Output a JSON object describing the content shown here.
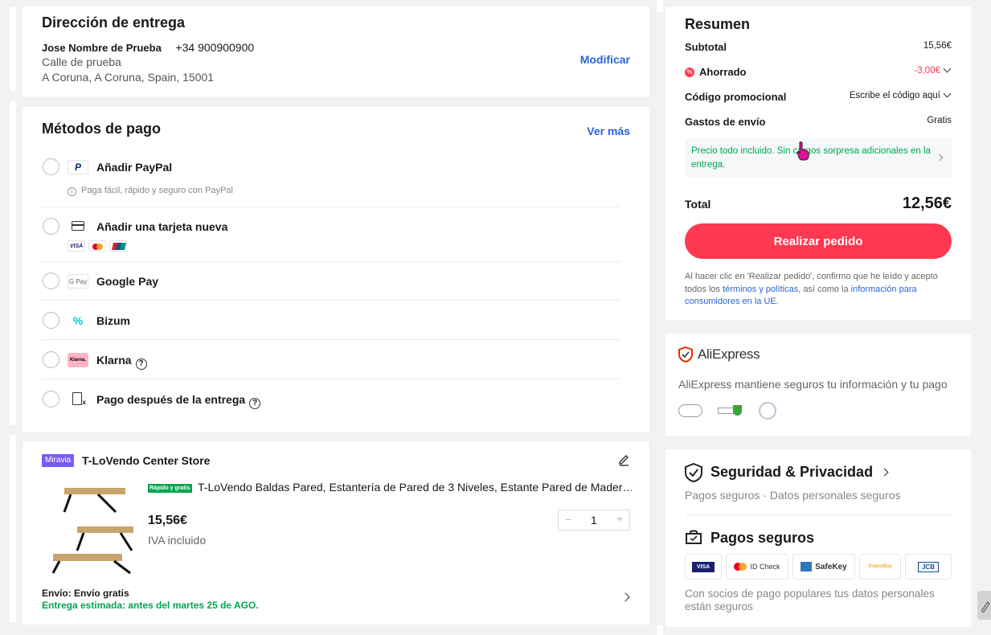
{
  "address": {
    "title": "Dirección de entrega",
    "name": "Jose Nombre de Prueba",
    "phone": "+34 900900900",
    "street": "Calle de prueba",
    "city": "A Coruna, A Coruna, Spain, 15001",
    "edit_label": "Modificar"
  },
  "payment": {
    "title": "Métodos de pago",
    "more_label": "Ver más",
    "methods": [
      {
        "label": "Añadir PayPal",
        "note": "Paga fácil, rápido y seguro con PayPal",
        "icon": "paypal-icon"
      },
      {
        "label": "Añadir una tarjeta nueva",
        "icon": "card-icon",
        "brands": [
          "VISA",
          "MC",
          "UP"
        ]
      },
      {
        "label": "Google Pay",
        "icon": "gpay-icon",
        "icon_text": "G Pay"
      },
      {
        "label": "Bizum",
        "icon": "bizum-icon"
      },
      {
        "label": "Klarna",
        "icon": "klarna-icon",
        "icon_text": "Klarna."
      },
      {
        "label": "Pago después de la entrega",
        "icon": "cod-icon"
      }
    ]
  },
  "order": {
    "store_badge": "Miravia",
    "store_name": "T-LoVendo Center Store",
    "fast_badge": "Rápido y gratis",
    "product_title": "T-LoVendo Baldas Pared, Estantería de Pared de 3 Niveles, Estante Pared de Mader…",
    "price": "15,56€",
    "tax_note": "IVA incluido",
    "quantity": "1",
    "shipping_label": "Envío: Envío gratis",
    "delivery_label": "Entrega estimada: antes del martes 25 de AGO."
  },
  "summary": {
    "title": "Resumen",
    "subtotal_label": "Subtotal",
    "subtotal_value": "15,56€",
    "saved_label": "Ahorrado",
    "saved_value": "-3,00€",
    "promo_label": "Código promocional",
    "promo_value": "Escribe el código aquí",
    "shipping_label": "Gastos de envío",
    "shipping_value": "Gratis",
    "notice": "Precio todo incluido. Sin cargos sorpresa adicionales en la entrega.",
    "total_label": "Total",
    "total_value": "12,56€",
    "place_order_label": "Realizar pedido",
    "legal_1": "Al hacer clic en 'Realizar pedido', confirmo que he leído y acepto todos los ",
    "legal_link_1": "términos y políticas",
    "legal_2": ", así como la ",
    "legal_link_2": "información para consumidores en la UE",
    "legal_3": "."
  },
  "trust": {
    "brand": "AliExpress",
    "text": "AliExpress mantiene seguros tu información y tu pago"
  },
  "security": {
    "title": "Seguridad & Privacidad",
    "subtitle": "Pagos seguros · Datos personales seguros",
    "pay_title": "Pagos seguros",
    "badges": [
      "VISA",
      "ID Check",
      "SafeKey",
      "ProtectBuy",
      "JCB"
    ],
    "footer": "Con socios de pago populares tus datos personales están seguros"
  },
  "colors": {
    "accent_red": "#fd384f",
    "link_blue": "#2a64d8",
    "green": "#00a651",
    "miravia_purple": "#7a5af8"
  }
}
